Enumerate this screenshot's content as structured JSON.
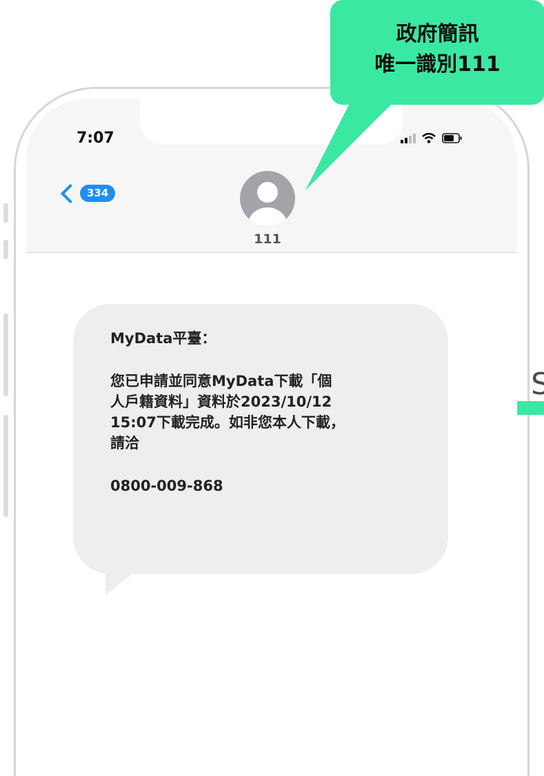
{
  "colors": {
    "accent_blue": "#1e8ef2",
    "callout_green": "#3be8a1",
    "bubble_gray": "#eeeeee",
    "header_gray": "#f6f6f6"
  },
  "callout": {
    "line1": "政府簡訊",
    "line2": "唯一識別111"
  },
  "status_bar": {
    "time": "7:07",
    "icons": [
      "signal-icon",
      "wifi-icon",
      "battery-icon"
    ]
  },
  "nav": {
    "back_icon": "chevron-left-icon",
    "unread_count": "334"
  },
  "contact": {
    "avatar_icon": "person-icon",
    "name": "111"
  },
  "message": {
    "title": "MyData平臺：",
    "body": "您已申請並同意MyData下載「個\n人戶籍資料」資料於2023/10/12\n15:07下載完成。如非您本人下載，\n請洽",
    "phone": "0800-009-868"
  },
  "side_fragment": {
    "letter": "S"
  }
}
